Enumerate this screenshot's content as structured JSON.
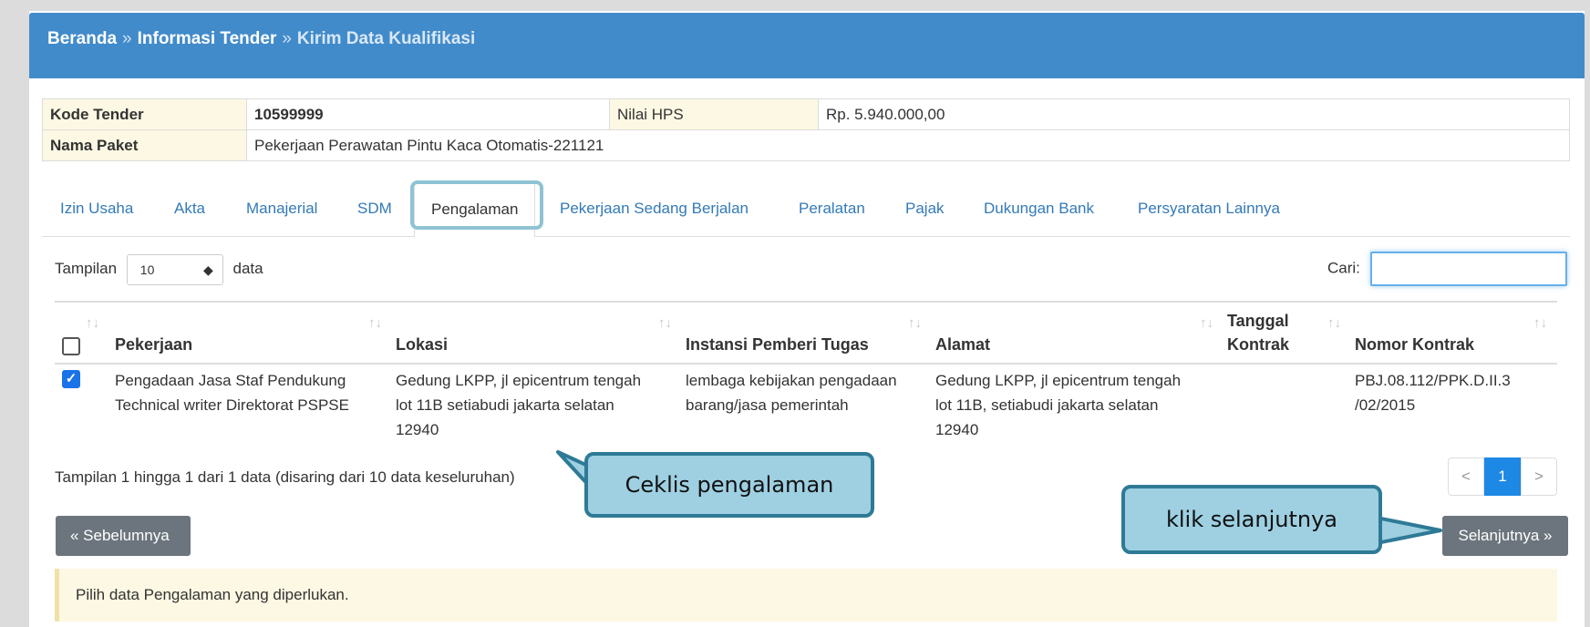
{
  "breadcrumb": {
    "home": "Beranda",
    "sep1": "»",
    "info": "Informasi Tender",
    "sep2": "»",
    "current": "Kirim Data Kualifikasi"
  },
  "info_table": {
    "kode_label": "Kode Tender",
    "kode_value": "10599999",
    "hps_label": "Nilai HPS",
    "hps_value": "Rp. 5.940.000,00",
    "paket_label": "Nama Paket",
    "paket_value": "Pekerjaan Perawatan Pintu Kaca Otomatis-221121"
  },
  "tabs": [
    {
      "label": "Izin Usaha"
    },
    {
      "label": "Akta"
    },
    {
      "label": "Manajerial"
    },
    {
      "label": "SDM"
    },
    {
      "label": "Pengalaman"
    },
    {
      "label": "Pekerjaan Sedang Berjalan"
    },
    {
      "label": "Peralatan"
    },
    {
      "label": "Pajak"
    },
    {
      "label": "Dukungan Bank"
    },
    {
      "label": "Persyaratan Lainnya"
    }
  ],
  "length": {
    "prefix": "Tampilan",
    "value": "10",
    "suffix": "data"
  },
  "search": {
    "label": "Cari:"
  },
  "table": {
    "headers": {
      "pekerjaan": "Pekerjaan",
      "lokasi": "Lokasi",
      "instansi": "Instansi Pemberi Tugas",
      "alamat": "Alamat",
      "tanggal1": "Tanggal",
      "tanggal2": "Kontrak",
      "nomor": "Nomor Kontrak"
    },
    "row": {
      "pekerjaan": [
        "Pengadaan Jasa Staf Pendukung",
        "Technical writer Direktorat PSPSE"
      ],
      "lokasi": [
        "Gedung LKPP, jl epicentrum tengah",
        "lot 11B setiabudi jakarta selatan",
        "12940"
      ],
      "instansi": [
        "lembaga kebijakan pengadaan",
        "barang/jasa pemerintah"
      ],
      "alamat": [
        "Gedung LKPP, jl epicentrum tengah",
        "lot 11B, setiabudi jakarta selatan",
        "12940"
      ],
      "nomor": [
        "PBJ.08.112/PPK.D.II.3",
        "/02/2015"
      ],
      "checked": true
    }
  },
  "info_text": "Tampilan 1 hingga 1 dari 1 data (disaring dari 10 data keseluruhan)",
  "pager": {
    "prev": "<",
    "current": "1",
    "next": ">"
  },
  "buttons": {
    "prev": "« Sebelumnya",
    "next": "Selanjutnya »"
  },
  "alert": "Pilih data Pengalaman yang diperlukan.",
  "callouts": {
    "check": "Ceklis pengalaman",
    "next": "klik selanjutnya"
  },
  "colors": {
    "header": "#428bca",
    "callout": "#9ed0e2",
    "callout_border": "#2e7a96",
    "link": "#337ab7"
  }
}
